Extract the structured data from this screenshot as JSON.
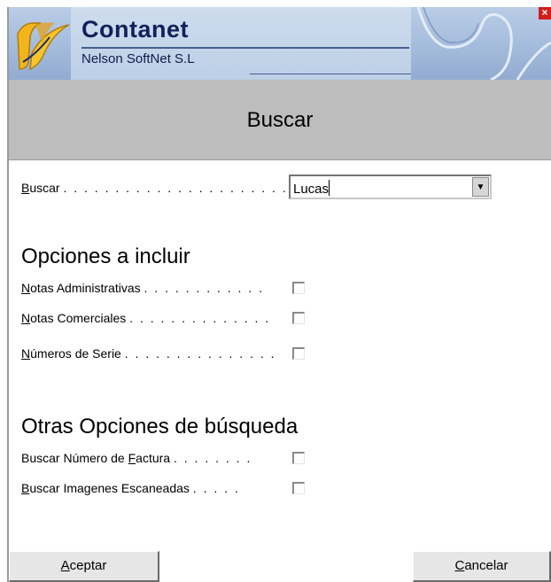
{
  "header": {
    "brand_name": "Contanet",
    "brand_sub": "Nelson SoftNet S.L",
    "close_label": "×"
  },
  "dialog": {
    "title": "Buscar"
  },
  "search": {
    "label_first": "B",
    "label_rest": "uscar",
    "leader": ". . . . . . . . . . . . . . . . . . . . . . . . .",
    "value": "Lucas"
  },
  "section_include": {
    "heading": "Opciones a incluir",
    "options": [
      {
        "first": "N",
        "rest": "otas Administrativas",
        "leader": ". . . . . . . . . . . ."
      },
      {
        "first": "N",
        "rest": "otas Comerciales",
        "leader": ". . . . . . . . . . . . . ."
      },
      {
        "first": "N",
        "rest": "úmeros de Serie",
        "leader": ". . . . . . . . . . . . . . ."
      }
    ]
  },
  "section_other": {
    "heading": "Otras Opciones de búsqueda",
    "options": [
      {
        "before": "Buscar Número de ",
        "underline": "F",
        "after": "actura",
        "leader": ". . . . . . . ."
      },
      {
        "before": "",
        "underline": "B",
        "after": "uscar Imagenes Escaneadas",
        "leader": ". . . . ."
      }
    ]
  },
  "buttons": {
    "ok": {
      "first": "A",
      "rest": "ceptar"
    },
    "cancel": {
      "first": "C",
      "rest": "ancelar"
    }
  },
  "colors": {
    "banner": "#a4bbdb",
    "titlebar": "#bdbdbd",
    "close": "#d21d1d"
  }
}
